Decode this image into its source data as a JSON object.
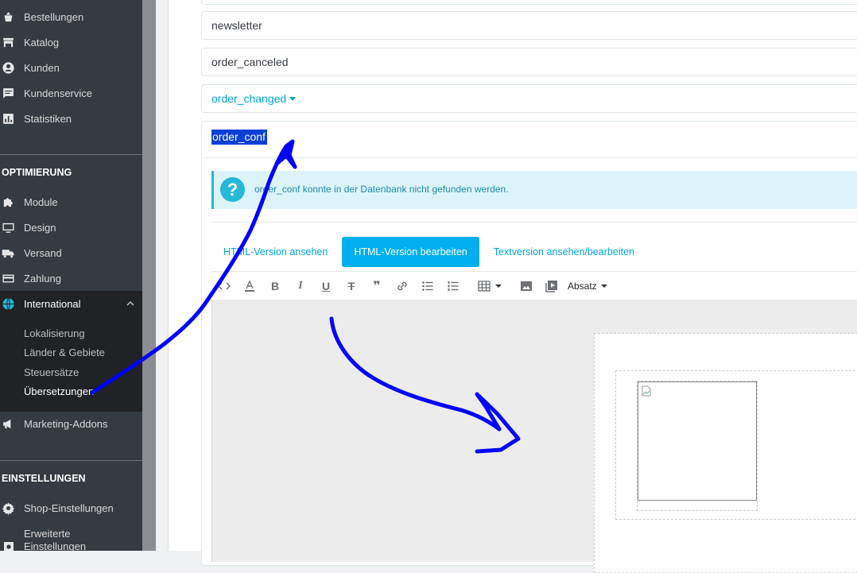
{
  "sidebar": {
    "items_top": [
      {
        "label": "Bestellungen",
        "icon": "basket-icon"
      },
      {
        "label": "Katalog",
        "icon": "store-icon"
      },
      {
        "label": "Kunden",
        "icon": "user-circle-icon"
      },
      {
        "label": "Kundenservice",
        "icon": "chat-icon"
      },
      {
        "label": "Statistiken",
        "icon": "chart-icon"
      }
    ],
    "section_optimierung": "OPTIMIERUNG",
    "items_opt": [
      {
        "label": "Module",
        "icon": "puzzle-icon"
      },
      {
        "label": "Design",
        "icon": "monitor-icon"
      },
      {
        "label": "Versand",
        "icon": "truck-icon"
      },
      {
        "label": "Zahlung",
        "icon": "credit-card-icon"
      },
      {
        "label": "International",
        "icon": "globe-icon"
      }
    ],
    "international_sub": [
      "Lokalisierung",
      "Länder & Gebiete",
      "Steuersätze",
      "Übersetzungen"
    ],
    "marketing": {
      "label": "Marketing-Addons",
      "icon": "megaphone-icon"
    },
    "section_einstellungen": "EINSTELLUNGEN",
    "items_settings": [
      {
        "label": "Shop-Einstellungen",
        "icon": "gear-icon"
      },
      {
        "label": "Erweiterte",
        "label2": "Einstellungen",
        "icon": "settings-advanced-icon"
      }
    ]
  },
  "templates": {
    "newsletter": "newsletter",
    "order_canceled": "order_canceled",
    "order_changed": "order_changed",
    "order_conf": "order_conf"
  },
  "alert": {
    "text": "order_conf konnte in der Datenbank nicht gefunden werden."
  },
  "tabs": [
    "HTML-Version ansehen",
    "HTML-Version bearbeiten",
    "Textversion ansehen/bearbeiten"
  ],
  "toolbar": {
    "format_select": "Absatz"
  },
  "colors": {
    "sidebar_bg": "#363a41",
    "accent": "#25b9d7",
    "tab_active": "#00aff0",
    "annotation_pen": "#0000ff"
  }
}
